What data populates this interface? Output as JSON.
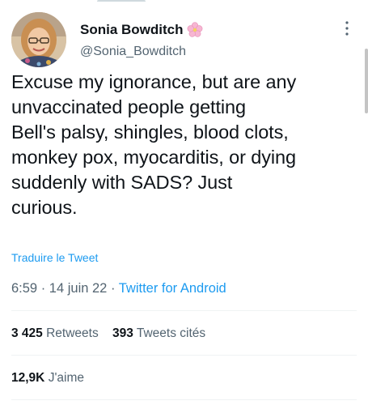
{
  "user": {
    "display_name": "Sonia Bowditch",
    "handle": "@Sonia_Bowditch",
    "emoji_icon": "cherry-blossom-icon"
  },
  "tweet": {
    "text": "Excuse my ignorance, but are any\nunvaccinated people getting\nBell's palsy, shingles, blood clots,\nmonkey pox, myocarditis, or dying\nsuddenly with SADS? Just\ncurious.",
    "translate_label": "Traduire le Tweet",
    "time": "6:59",
    "separator": " · ",
    "date": "14 juin 22",
    "source": "Twitter for Android"
  },
  "stats": {
    "retweets_count": "3 425",
    "retweets_label": "Retweets",
    "quotes_count": "393",
    "quotes_label": "Tweets cités",
    "likes_count": "12,9K",
    "likes_label": "J'aime"
  },
  "colors": {
    "link": "#1d9bf0",
    "text": "#0f1419",
    "secondary": "#536471"
  }
}
